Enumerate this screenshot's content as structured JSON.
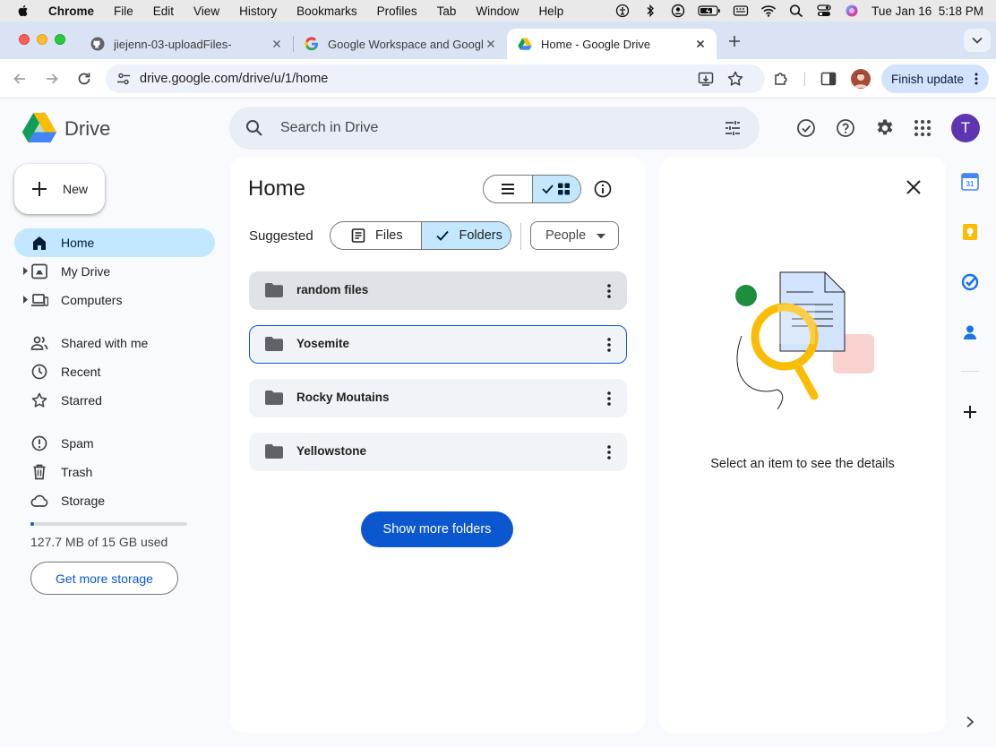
{
  "menubar": {
    "app": "Chrome",
    "items": [
      "File",
      "Edit",
      "View",
      "History",
      "Bookmarks",
      "Profiles",
      "Tab",
      "Window",
      "Help"
    ],
    "clock": "Tue Jan 16  5:18 PM"
  },
  "tabs": [
    {
      "title": "jiejenn-03-uploadFiles-",
      "icon": "github-icon"
    },
    {
      "title": "Google Workspace and Googl",
      "icon": "google-icon"
    },
    {
      "title": "Home - Google Drive",
      "icon": "drive-icon",
      "active": true
    }
  ],
  "toolbar": {
    "url": "drive.google.com/drive/u/1/home",
    "finish_update": "Finish update"
  },
  "drive": {
    "brand": "Drive",
    "search_placeholder": "Search in Drive",
    "avatar_letter": "T"
  },
  "sidebar": {
    "new_label": "New",
    "items": [
      {
        "label": "Home",
        "icon": "home-icon",
        "selected": true
      },
      {
        "label": "My Drive",
        "icon": "my-drive-icon"
      },
      {
        "label": "Computers",
        "icon": "computers-icon"
      },
      {
        "label": "Shared with me",
        "icon": "shared-icon"
      },
      {
        "label": "Recent",
        "icon": "clock-icon"
      },
      {
        "label": "Starred",
        "icon": "star-icon"
      },
      {
        "label": "Spam",
        "icon": "spam-icon"
      },
      {
        "label": "Trash",
        "icon": "trash-icon"
      },
      {
        "label": "Storage",
        "icon": "cloud-icon"
      }
    ],
    "storage_used_fraction": 0.0085,
    "storage_text": "127.7 MB of 15 GB used",
    "get_more": "Get more storage"
  },
  "main": {
    "title": "Home",
    "suggested": "Suggested",
    "chip_files": "Files",
    "chip_folders": "Folders",
    "people": "People",
    "folders": [
      "random files",
      "Yosemite",
      "Rocky Moutains",
      "Yellowstone"
    ],
    "show_more": "Show more folders"
  },
  "details": {
    "empty_text": "Select an item to see the details"
  },
  "colors": {
    "accent": "#0b57d0",
    "selected": "#c2e7ff",
    "avatar": "#5e35b1"
  }
}
